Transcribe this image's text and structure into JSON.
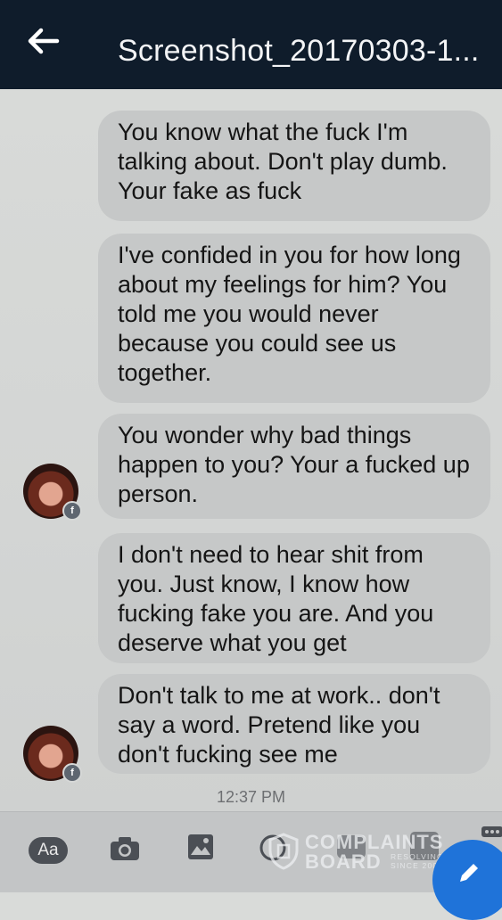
{
  "header": {
    "title": "Screenshot_20170303-1...",
    "back_icon": "arrow-left-icon"
  },
  "messages": [
    {
      "text": "You know what the fuck I'm\ntalking about. Don't play dumb.\nYour fake as fuck"
    },
    {
      "text": "I've confided in you for how long\nabout my feelings for him? You\ntold me you would never\nbecause you could see us\ntogether."
    },
    {
      "text": "You wonder why bad things\nhappen to you? Your a fucked up\nperson."
    },
    {
      "text": "I don't need to hear shit from\nyou. Just know, I know how\nfucking fake you are. And you\ndeserve what you get"
    },
    {
      "text": "Don't talk to me at work.. don't\nsay a word. Pretend like you\ndon't fucking see me"
    }
  ],
  "timestamp": "12:37 PM",
  "composer": {
    "aa_label": "Aa",
    "icons": [
      "camera-icon",
      "image-icon",
      "gif-icon",
      "mic-icon",
      "more-icon"
    ]
  },
  "watermark": {
    "line1": "COMPLAINTS",
    "line2": "BOARD",
    "tag1": "RESOLVING",
    "tag2": "SINCE 2004"
  },
  "colors": {
    "header_bg": "#0f1c2b",
    "bubble_bg": "#c6c8c8",
    "fab": "#1f73d9"
  }
}
